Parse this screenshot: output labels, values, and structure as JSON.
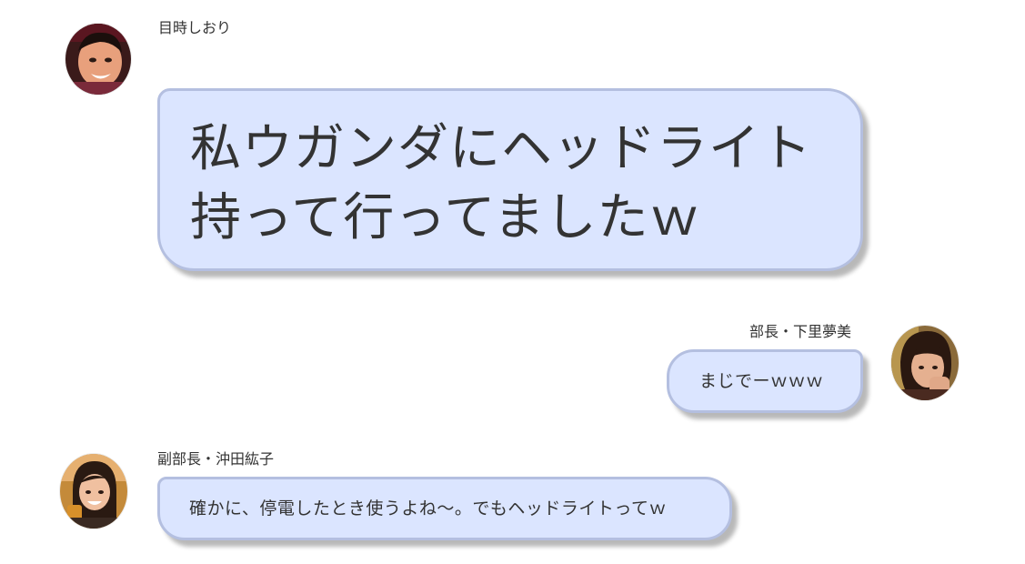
{
  "messages": [
    {
      "sender": "目時しおり",
      "avatar": "avatar-photo-shiori",
      "side": "left",
      "lines": [
        "私ウガンダにヘッドライト",
        "持って行ってましたｗ"
      ]
    },
    {
      "sender": "部長・下里夢美",
      "avatar": "avatar-photo-shimosato",
      "side": "right",
      "text": "まじでーｗｗｗ"
    },
    {
      "sender": "副部長・沖田紘子",
      "avatar": "avatar-photo-okita",
      "side": "left",
      "text": "確かに、停電したとき使うよね～。でもヘッドライトってｗ"
    }
  ],
  "colors": {
    "bubble_fill": "#dbe5ff",
    "bubble_border": "#b4bfe0",
    "text": "#333333"
  }
}
